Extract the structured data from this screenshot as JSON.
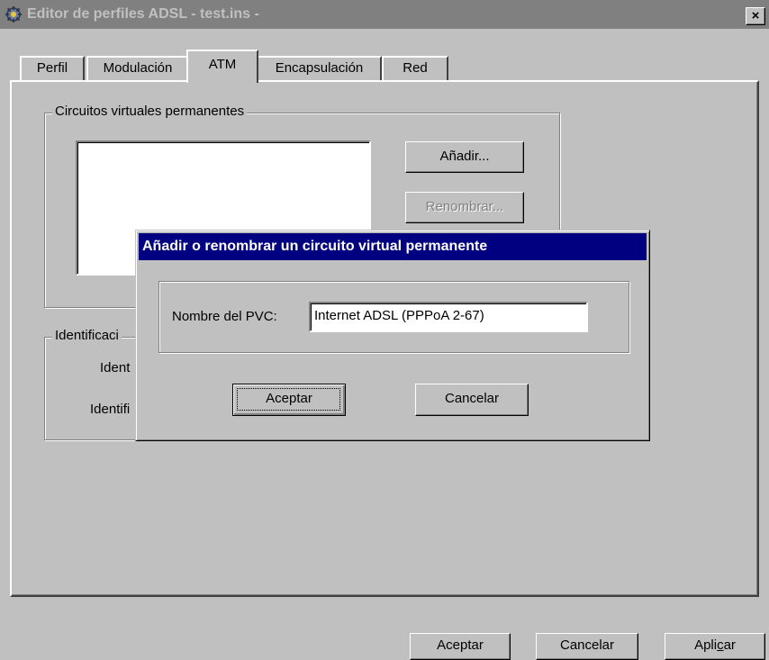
{
  "window": {
    "title": "Editor de perfiles ADSL - test.ins -",
    "close_glyph": "×"
  },
  "tabs": [
    {
      "label": "Perfil"
    },
    {
      "label": "Modulación"
    },
    {
      "label": "ATM",
      "active": true
    },
    {
      "label": "Encapsulación"
    },
    {
      "label": "Red"
    }
  ],
  "atm_page": {
    "pvc_group": {
      "legend": "Circuitos virtuales permanentes",
      "add_button": "Añadir...",
      "rename_button": "Renombrar..."
    },
    "identification_group": {
      "legend": "Identificaci",
      "label_1": "Ident",
      "label_2": "Identifi"
    }
  },
  "footer": {
    "ok_button": "Aceptar",
    "cancel_button": "Cancelar",
    "apply_button_pre": "Apli",
    "apply_button_accel": "c",
    "apply_button_post": "ar"
  },
  "dialog": {
    "title": "Añadir o renombrar un circuito virtual permanente",
    "field_label": "Nombre del PVC:",
    "field_value": "Internet ADSL (PPPoA 2-67)",
    "ok_button": "Aceptar",
    "cancel_button": "Cancelar"
  },
  "colors": {
    "dialog_title_bg": "#000080",
    "inactive_title_bg": "#808080",
    "face": "#c0c0c0"
  }
}
